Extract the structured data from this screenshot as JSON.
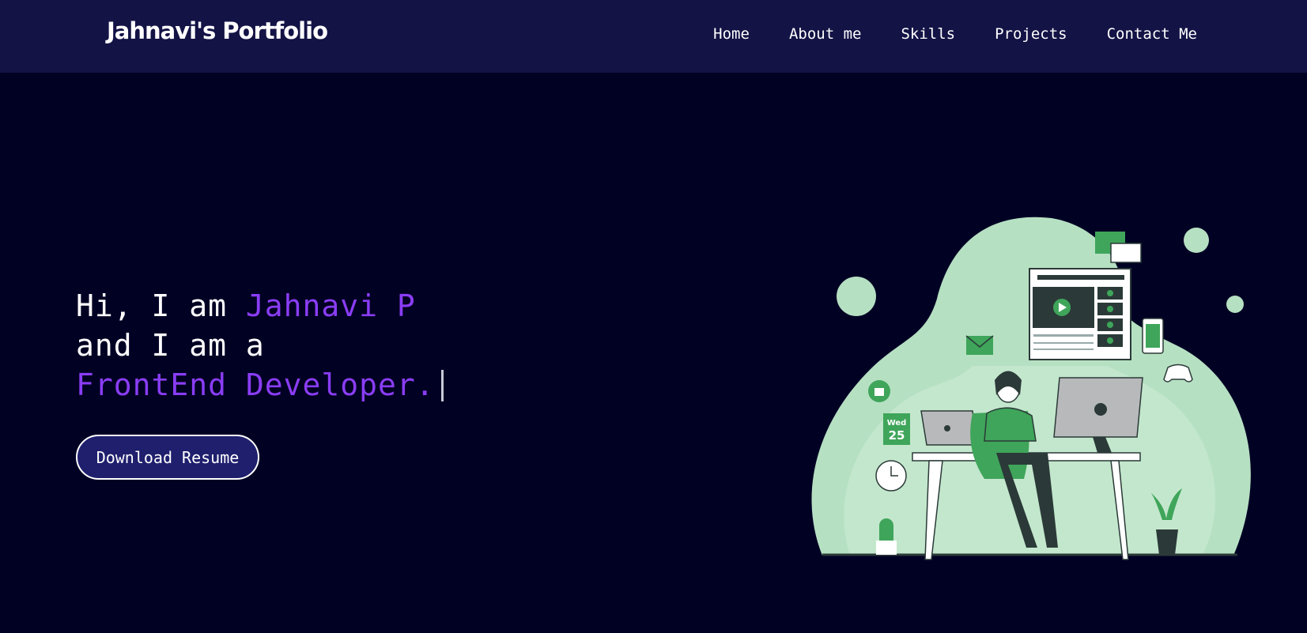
{
  "navbar": {
    "brand": "Jahnavi's Portfolio",
    "links": [
      "Home",
      "About me",
      "Skills",
      "Projects",
      "Contact Me"
    ]
  },
  "hero": {
    "greeting": "Hi, I am ",
    "name": "Jahnavi P",
    "line2": "and I am a",
    "role": "FrontEnd Developer.",
    "button": "Download Resume"
  },
  "illustration": {
    "calendar_day": "Wed",
    "calendar_date": "25",
    "icons": [
      "play-icon",
      "mail-icon",
      "thumbs-up-icon",
      "clock-icon",
      "gamepad-icon",
      "phone-icon"
    ]
  },
  "colors": {
    "background": "#010124",
    "navbar": "#131346",
    "accent": "#8a3df5",
    "button": "#1f1f6e",
    "illustration_green": "#3fa55a",
    "illustration_mint": "#b6e0c2"
  }
}
